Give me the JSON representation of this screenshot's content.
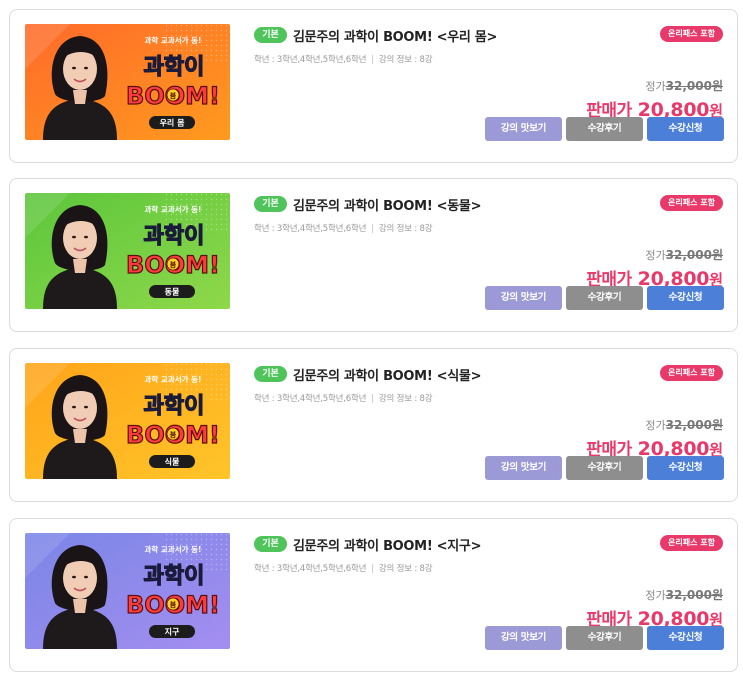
{
  "courses": [
    {
      "badge": "기본",
      "title": "김문주의 과학이 BOOM! <우리 몸>",
      "grade_label": "학년 : 3학년,4학년,5학년,6학년",
      "lecture_info": "강의 정보 : 8강",
      "pass_badge": "온리패스 포함",
      "list_price_label": "정가",
      "list_price": "32,000",
      "list_price_unit": "원",
      "sale_label": "판매가",
      "sale_price": "20,800",
      "sale_unit": "원",
      "buttons": {
        "preview": "강의 맛보기",
        "review": "수강후기",
        "apply": "수강신청"
      },
      "thumbnail": {
        "tagline": "과학 교과서가 동!",
        "logo_top": "과학이",
        "logo_bottom": "BOOM!",
        "logo_mid": "붐",
        "subject": "우리 몸",
        "bg_colors": [
          "#ff6a2a",
          "#ff9b1e"
        ]
      }
    },
    {
      "badge": "기본",
      "title": "김문주의 과학이 BOOM! <동물>",
      "grade_label": "학년 : 3학년,4학년,5학년,6학년",
      "lecture_info": "강의 정보 : 8강",
      "pass_badge": "온리패스 포함",
      "list_price_label": "정가",
      "list_price": "32,000",
      "list_price_unit": "원",
      "sale_label": "판매가",
      "sale_price": "20,800",
      "sale_unit": "원",
      "buttons": {
        "preview": "강의 맛보기",
        "review": "수강후기",
        "apply": "수강신청"
      },
      "thumbnail": {
        "tagline": "과학 교과서가 동!",
        "logo_top": "과학이",
        "logo_bottom": "BOOM!",
        "logo_mid": "붐",
        "subject": "동물",
        "bg_colors": [
          "#5cc63c",
          "#8fd84a"
        ]
      }
    },
    {
      "badge": "기본",
      "title": "김문주의 과학이 BOOM! <식물>",
      "grade_label": "학년 : 3학년,4학년,5학년,6학년",
      "lecture_info": "강의 정보 : 8강",
      "pass_badge": "온리패스 포함",
      "list_price_label": "정가",
      "list_price": "32,000",
      "list_price_unit": "원",
      "sale_label": "판매가",
      "sale_price": "20,800",
      "sale_unit": "원",
      "buttons": {
        "preview": "강의 맛보기",
        "review": "수강후기",
        "apply": "수강신청"
      },
      "thumbnail": {
        "tagline": "과학 교과서가 동!",
        "logo_top": "과학이",
        "logo_bottom": "BOOM!",
        "logo_mid": "붐",
        "subject": "식물",
        "bg_colors": [
          "#ffa41a",
          "#ffc529"
        ]
      }
    },
    {
      "badge": "기본",
      "title": "김문주의 과학이 BOOM! <지구>",
      "grade_label": "학년 : 3학년,4학년,5학년,6학년",
      "lecture_info": "강의 정보 : 8강",
      "pass_badge": "온리패스 포함",
      "list_price_label": "정가",
      "list_price": "32,000",
      "list_price_unit": "원",
      "sale_label": "판매가",
      "sale_price": "20,800",
      "sale_unit": "원",
      "buttons": {
        "preview": "강의 맛보기",
        "review": "수강후기",
        "apply": "수강신청"
      },
      "thumbnail": {
        "tagline": "과학 교과서가 동!",
        "logo_top": "과학이",
        "logo_bottom": "BOOM!",
        "logo_mid": "붐",
        "subject": "지구",
        "bg_colors": [
          "#7a86e6",
          "#a48ef0"
        ]
      }
    }
  ],
  "colors": {
    "basic_badge": "#4ec45a",
    "pass_badge": "#e8396a",
    "sale_price": "#e8396a",
    "preview_button": "#9b99d6",
    "review_button": "#8e8e8e",
    "apply_button": "#4b7fd8"
  }
}
